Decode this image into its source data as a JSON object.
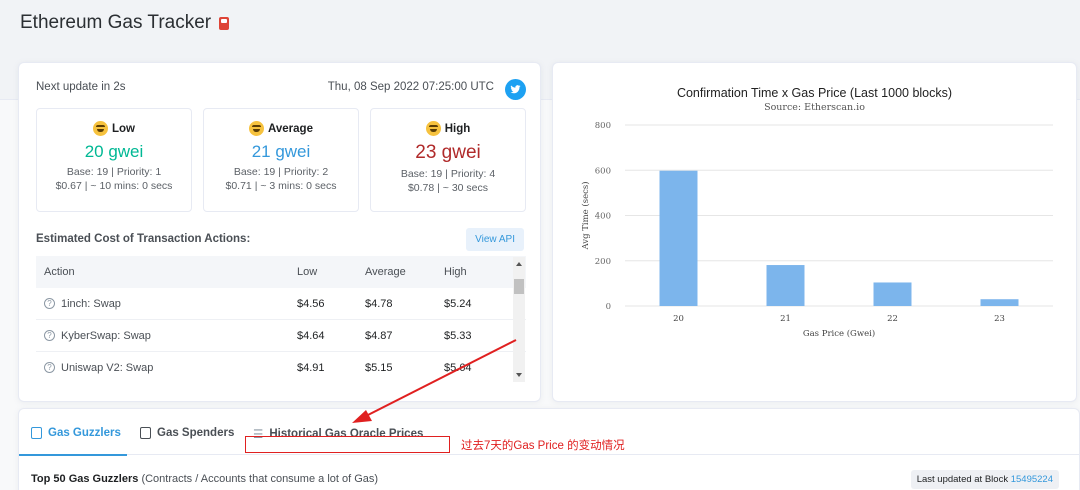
{
  "page": {
    "title": "Ethereum Gas Tracker"
  },
  "gas": {
    "next_update": "Next update in 2s",
    "timestamp": "Thu, 08 Sep 2022 07:25:00 UTC",
    "tiers": [
      {
        "label": "Low",
        "price": "20 gwei",
        "base": "Base: 19 | Priority: 1",
        "cost": "$0.67 | ~ 10 mins: 0 secs",
        "color": "#00b894"
      },
      {
        "label": "Average",
        "price": "21 gwei",
        "base": "Base: 19 | Priority: 2",
        "cost": "$0.71 | ~ 3 mins: 0 secs",
        "color": "#3498db"
      },
      {
        "label": "High",
        "price": "23 gwei",
        "base": "Base: 19 | Priority: 4",
        "cost": "$0.78 | ~ 30 secs",
        "color": "#b02a2a"
      }
    ],
    "estimated_title": "Estimated Cost of Transaction Actions:",
    "view_api": "View API",
    "table": {
      "headers": [
        "Action",
        "Low",
        "Average",
        "High"
      ],
      "rows": [
        {
          "action": "1inch: Swap",
          "low": "$4.56",
          "avg": "$4.78",
          "high": "$5.24"
        },
        {
          "action": "KyberSwap: Swap",
          "low": "$4.64",
          "avg": "$4.87",
          "high": "$5.33"
        },
        {
          "action": "Uniswap V2: Swap",
          "low": "$4.91",
          "avg": "$5.15",
          "high": "$5.64"
        }
      ]
    }
  },
  "chart_data": {
    "type": "bar",
    "title": "Confirmation Time x Gas Price (Last 1000 blocks)",
    "subtitle": "Source: Etherscan.io",
    "xlabel": "Gas Price (Gwei)",
    "ylabel": "Avg Time (secs)",
    "categories": [
      "20",
      "21",
      "22",
      "23"
    ],
    "values": [
      598,
      181,
      104,
      30
    ],
    "ylim": [
      0,
      800
    ],
    "yticks": [
      0,
      200,
      400,
      600,
      800
    ],
    "bar_color": "#7cb5ec",
    "grid": true
  },
  "tabs": {
    "items": [
      {
        "label": "Gas Guzzlers",
        "active": true
      },
      {
        "label": "Gas Spenders",
        "active": false
      },
      {
        "label": "Historical Gas Oracle Prices",
        "active": false
      }
    ],
    "annotation": "过去7天的Gas Price 的变动情况",
    "top50_bold": "Top 50 Gas Guzzlers",
    "top50_rest": " (Contracts / Accounts that consume a lot of Gas)",
    "last_updated_label": "Last updated at Block ",
    "last_updated_block": "15495224"
  }
}
